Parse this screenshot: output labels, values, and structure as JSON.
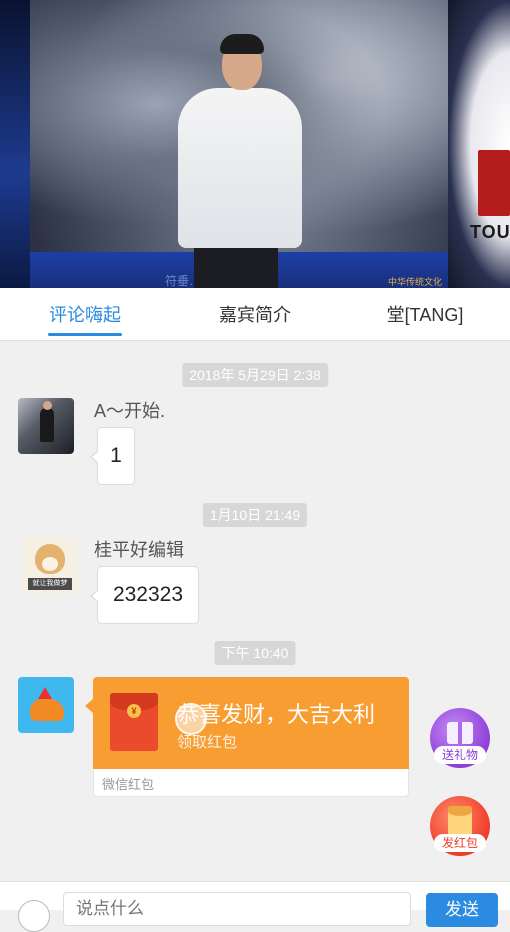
{
  "video": {
    "caption": "符垂… 落修复",
    "caption_right": "中华传统文化",
    "logo_text": "TOU"
  },
  "tabs": [
    {
      "label": "评论嗨起",
      "active": true
    },
    {
      "label": "嘉宾简介",
      "active": false
    },
    {
      "label": "堂[TANG]",
      "active": false
    }
  ],
  "chat": {
    "messages": [
      {
        "timestamp": "2018年 5月29日 2:38",
        "user": "A～开始.",
        "text": "1",
        "avatar": "photo-avatar"
      },
      {
        "timestamp": "1月10日 21:49",
        "user": "桂平好编辑",
        "text": "232323",
        "avatar": "doge-avatar",
        "avatar_tag": "就让我做梦"
      },
      {
        "timestamp": "下午 10:40",
        "avatar": "elephant-avatar"
      }
    ],
    "red_packet": {
      "greeting": "恭喜发财，大吉大利",
      "claim": "领取红包",
      "footer": "微信红包",
      "coin_symbol": "¥"
    }
  },
  "fabs": {
    "gift_label": "送礼物",
    "red_packet_label": "发红包"
  },
  "input": {
    "placeholder": "说点什么",
    "send_label": "发送"
  },
  "colors": {
    "accent": "#2a8be0",
    "packet": "#f79d32",
    "gift": "#8d3fd8",
    "redpkt": "#ef3b2a"
  }
}
